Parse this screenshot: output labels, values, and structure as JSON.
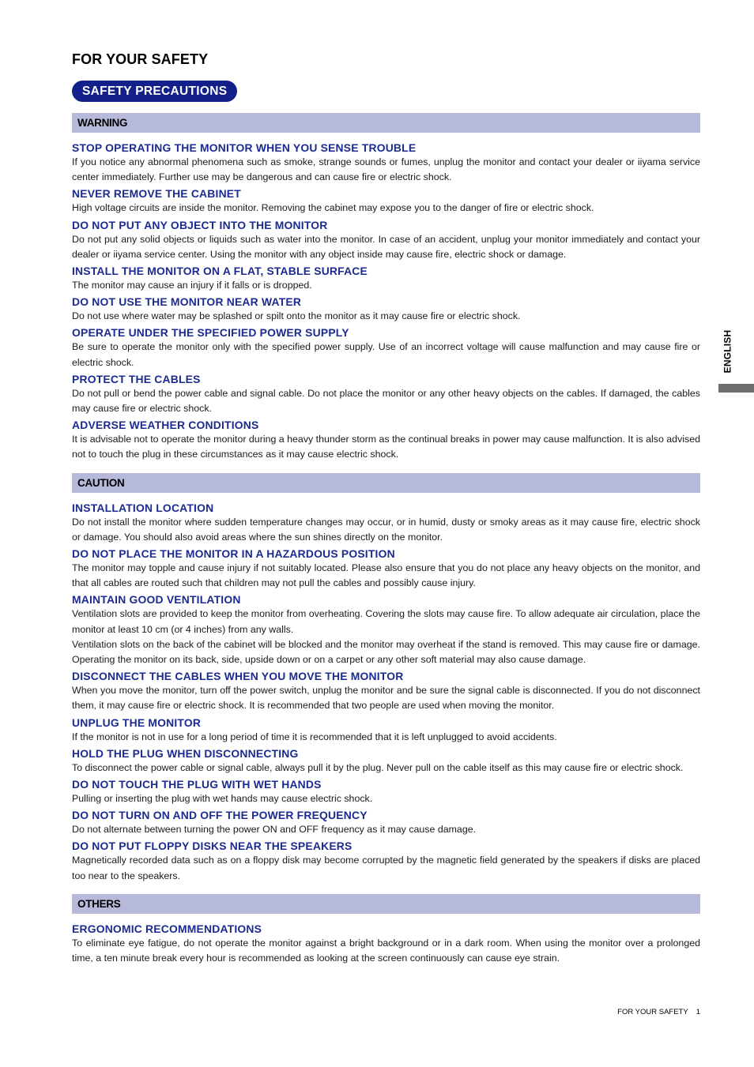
{
  "page_title": "FOR YOUR SAFETY",
  "section_pill": "SAFETY PRECAUTIONS",
  "side_tab": "ENGLISH",
  "colors": {
    "heading": "#1b2b90",
    "pill": "#13208a",
    "bar": "#b7b9da",
    "side_block": "#6e6e6e"
  },
  "sections": [
    {
      "title": "WARNING",
      "items": [
        {
          "heading": "STOP OPERATING THE MONITOR WHEN YOU SENSE TROUBLE",
          "paragraphs": [
            "If you notice any abnormal phenomena such as smoke, strange sounds or fumes, unplug the monitor and contact your dealer or iiyama service center immediately. Further use may be dangerous and can cause fire or electric shock."
          ]
        },
        {
          "heading": "NEVER REMOVE THE CABINET",
          "paragraphs": [
            "High voltage circuits are inside the monitor. Removing the cabinet may expose you to the danger of fire or electric shock."
          ]
        },
        {
          "heading": "DO NOT PUT ANY OBJECT INTO THE MONITOR",
          "paragraphs": [
            "Do not put any solid objects or liquids such as water into the monitor. In case of an accident, unplug your monitor immediately and contact your dealer or iiyama service center. Using the monitor with any object inside may cause fire, electric shock or damage."
          ]
        },
        {
          "heading": "INSTALL THE MONITOR ON A FLAT, STABLE SURFACE",
          "paragraphs": [
            "The monitor may cause an injury if it falls or is dropped."
          ]
        },
        {
          "heading": "DO NOT USE THE MONITOR NEAR WATER",
          "paragraphs": [
            "Do not use where water may be splashed or spilt onto the monitor as it may cause fire or electric shock."
          ]
        },
        {
          "heading": "OPERATE UNDER THE SPECIFIED POWER SUPPLY",
          "paragraphs": [
            "Be sure to operate the monitor only with the specified power supply. Use of an incorrect voltage will cause malfunction and may cause fire or electric shock."
          ]
        },
        {
          "heading": "PROTECT THE CABLES",
          "paragraphs": [
            "Do not pull or bend the power cable and signal cable. Do not place the monitor or any other heavy objects on the cables. If damaged, the cables may cause fire or electric shock."
          ]
        },
        {
          "heading": "ADVERSE WEATHER CONDITIONS",
          "paragraphs": [
            "It is advisable not to operate the monitor during a heavy thunder storm as the continual breaks in power may cause malfunction. It is also advised not to touch the plug in these circumstances as it may cause electric shock."
          ]
        }
      ]
    },
    {
      "title": "CAUTION",
      "items": [
        {
          "heading": "INSTALLATION LOCATION",
          "paragraphs": [
            "Do not install the monitor where sudden temperature changes may occur, or in humid, dusty or smoky areas as it may cause fire, electric shock or damage. You should also avoid areas where the sun shines directly on the monitor."
          ]
        },
        {
          "heading": "DO NOT PLACE THE MONITOR IN A HAZARDOUS POSITION",
          "paragraphs": [
            "The monitor may topple and cause injury if not suitably located. Please also ensure that you do not place any heavy objects on the monitor, and that all cables are routed such that children may not pull the cables and possibly cause injury."
          ]
        },
        {
          "heading": "MAINTAIN GOOD VENTILATION",
          "paragraphs": [
            "Ventilation slots are provided to keep the monitor from overheating. Covering the slots may cause fire. To allow adequate air circulation, place the monitor at least 10 cm (or 4 inches) from any walls.",
            "Ventilation slots on the back of the cabinet will be blocked and the monitor may overheat if the stand is removed. This may cause fire or damage. Operating the monitor on its back, side, upside down or on a carpet or any other soft material may also cause damage."
          ]
        },
        {
          "heading": "DISCONNECT THE CABLES WHEN YOU MOVE THE MONITOR",
          "paragraphs": [
            "When you move the monitor, turn off the power switch, unplug the monitor and be sure the signal cable is disconnected. If you do not disconnect them, it may cause fire or electric shock. It is recommended that two people are used when moving the monitor."
          ]
        },
        {
          "heading": "UNPLUG THE MONITOR",
          "paragraphs": [
            "If the monitor is not in use for a long period of time it is recommended that it is left unplugged to avoid accidents."
          ]
        },
        {
          "heading": "HOLD THE PLUG WHEN DISCONNECTING",
          "paragraphs": [
            "To disconnect the power cable or signal cable, always pull it by the plug. Never pull on the cable itself as this may cause fire or electric shock."
          ]
        },
        {
          "heading": "DO NOT TOUCH THE PLUG WITH WET HANDS",
          "paragraphs": [
            "Pulling or inserting the plug with wet hands may cause electric shock."
          ]
        },
        {
          "heading": "DO NOT TURN ON AND OFF THE POWER FREQUENCY",
          "paragraphs": [
            "Do not alternate between turning the power ON and OFF frequency as it may cause damage."
          ]
        },
        {
          "heading": "DO NOT PUT FLOPPY DISKS NEAR THE SPEAKERS",
          "paragraphs": [
            "Magnetically recorded data such as on a floppy disk may become corrupted by the magnetic field generated by the speakers if disks are placed too near to the speakers."
          ]
        }
      ]
    },
    {
      "title": "OTHERS",
      "items": [
        {
          "heading": "ERGONOMIC RECOMMENDATIONS",
          "paragraphs": [
            "To eliminate eye fatigue, do not operate the monitor against a bright background or in a dark room. When using the monitor over a prolonged time, a ten minute break every hour is recommended as looking at the screen continuously can cause eye strain."
          ]
        }
      ]
    }
  ],
  "footer": {
    "label": "FOR YOUR SAFETY",
    "page_number": "1"
  }
}
